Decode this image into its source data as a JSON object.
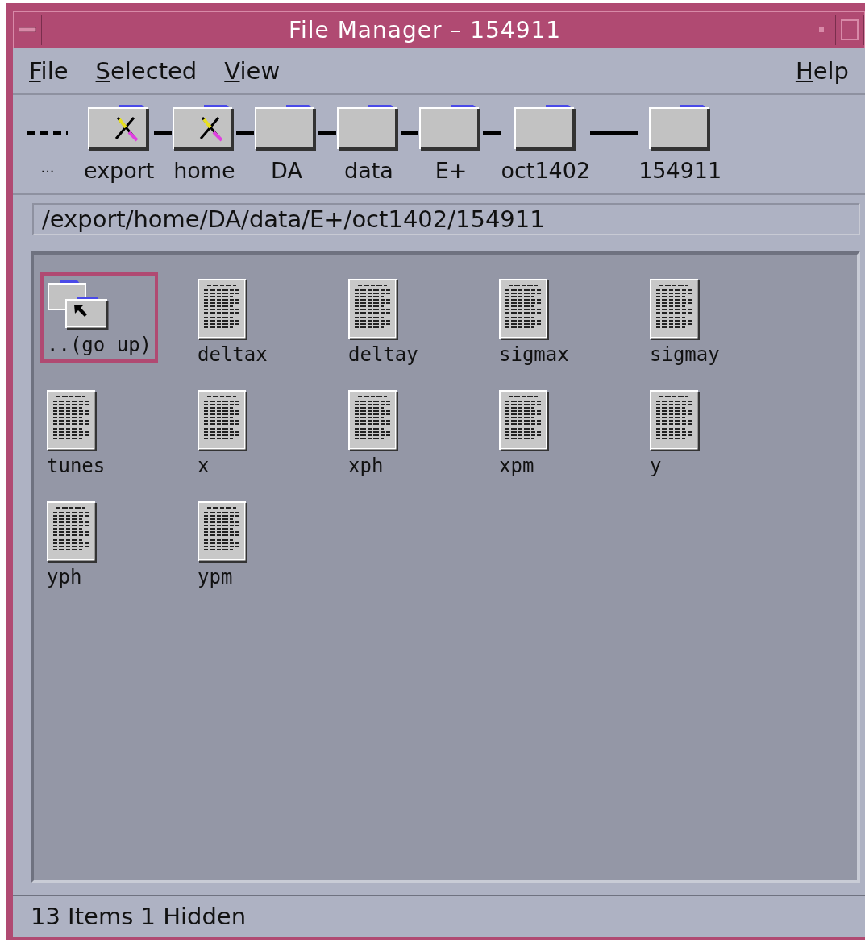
{
  "window": {
    "title": "File Manager – 154911"
  },
  "menu": [
    "File",
    "Selected",
    "View"
  ],
  "help_menu": "Help",
  "breadcrumb": {
    "lead": "...",
    "folders": [
      {
        "label": "export",
        "no_write": true
      },
      {
        "label": "home",
        "no_write": true
      },
      {
        "label": "DA",
        "no_write": false
      },
      {
        "label": "data",
        "no_write": false
      },
      {
        "label": "E+",
        "no_write": false
      },
      {
        "label": "oct1402",
        "no_write": false
      },
      {
        "label": "154911",
        "no_write": false
      }
    ]
  },
  "path": "/export/home/DA/data/E+/oct1402/154911",
  "items": [
    {
      "name": "..(go up)",
      "kind": "parent",
      "selected": true
    },
    {
      "name": "deltax",
      "kind": "file",
      "selected": false
    },
    {
      "name": "deltay",
      "kind": "file",
      "selected": false
    },
    {
      "name": "sigmax",
      "kind": "file",
      "selected": false
    },
    {
      "name": "sigmay",
      "kind": "file",
      "selected": false
    },
    {
      "name": "tunes",
      "kind": "file",
      "selected": false
    },
    {
      "name": "x",
      "kind": "file",
      "selected": false
    },
    {
      "name": "xph",
      "kind": "file",
      "selected": false
    },
    {
      "name": "xpm",
      "kind": "file",
      "selected": false
    },
    {
      "name": "y",
      "kind": "file",
      "selected": false
    },
    {
      "name": "yph",
      "kind": "file",
      "selected": false
    },
    {
      "name": "ypm",
      "kind": "file",
      "selected": false
    }
  ],
  "status_bar": "13 Items 1 Hidden"
}
